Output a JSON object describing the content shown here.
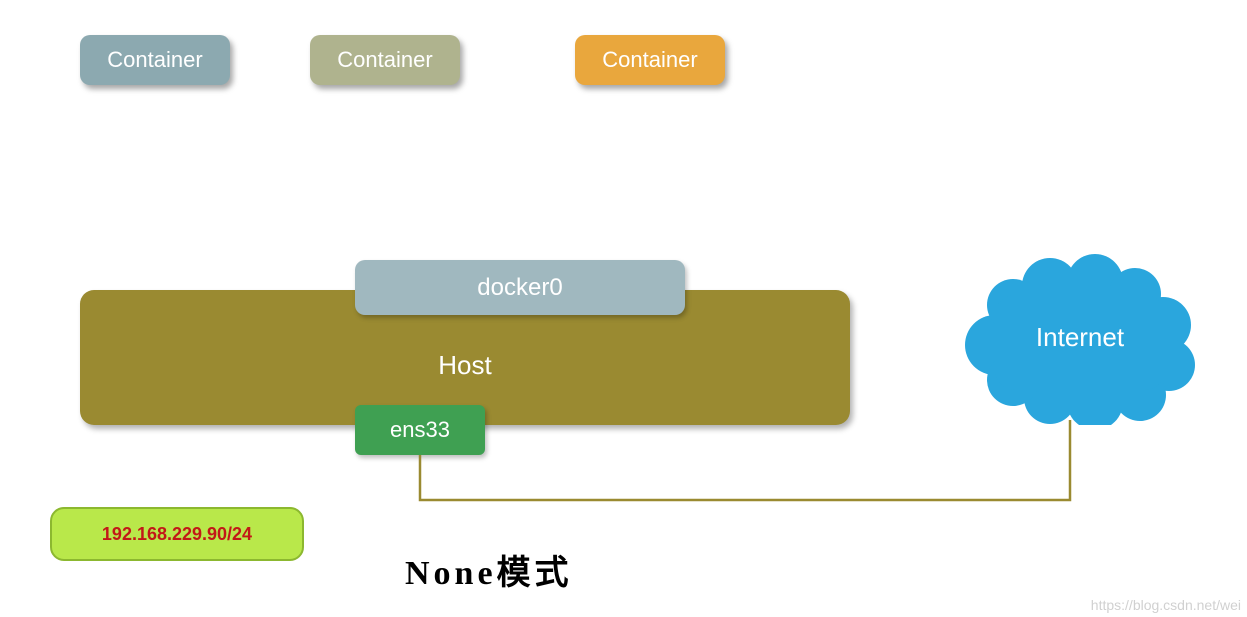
{
  "containers": [
    {
      "label": "Container"
    },
    {
      "label": "Container"
    },
    {
      "label": "Container"
    }
  ],
  "host": {
    "label": "Host",
    "bridge": "docker0",
    "nic": "ens33"
  },
  "ip": "192.168.229.90/24",
  "internet": "Internet",
  "title": "None模式",
  "watermark": "https://blog.csdn.net/wei"
}
